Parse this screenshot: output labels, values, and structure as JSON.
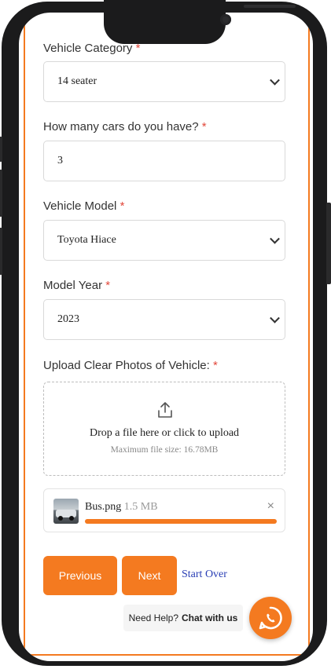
{
  "form": {
    "vehicle_category": {
      "label": "Vehicle Category",
      "required": "*",
      "value": "14 seater"
    },
    "car_count": {
      "label": "How many cars do you have?",
      "required": "*",
      "value": "3"
    },
    "vehicle_model": {
      "label": "Vehicle Model",
      "required": "*",
      "value": "Toyota Hiace"
    },
    "model_year": {
      "label": "Model Year",
      "required": "*",
      "value": "2023"
    },
    "upload": {
      "label": "Upload Clear Photos of Vehicle:",
      "required": "*",
      "prompt": "Drop a file here or click to upload",
      "max_size": "Maximum file size: 16.78MB",
      "icon": "upload-icon"
    },
    "file": {
      "name": "Bus.png",
      "size": "1.5 MB",
      "progress": 1.0,
      "remove": "×"
    }
  },
  "actions": {
    "previous": "Previous",
    "next": "Next",
    "start_over": "Start Over"
  },
  "help": {
    "text": "Need Help?",
    "link": "Chat with us",
    "icon": "whatsapp-icon"
  },
  "colors": {
    "accent": "#f47a20",
    "required": "#e2483b",
    "link": "#2a3fb5"
  }
}
